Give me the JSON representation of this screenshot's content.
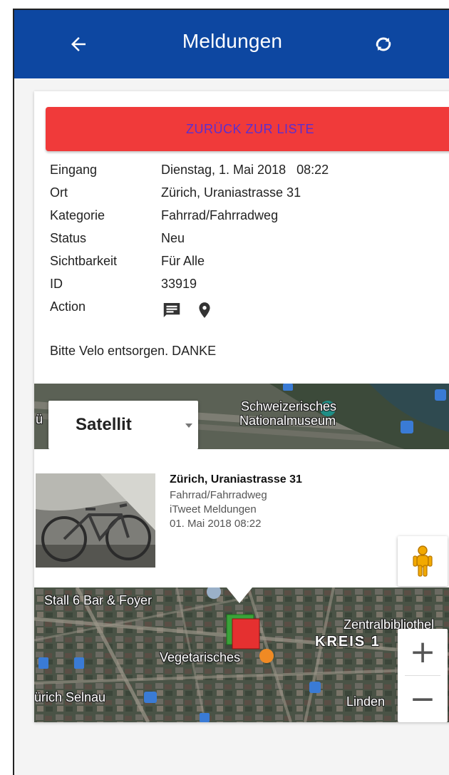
{
  "appbar": {
    "title": "Meldungen",
    "back_icon": "arrow-left-icon",
    "refresh_icon": "refresh-icon",
    "bg_color": "#0d47a1"
  },
  "back_button": {
    "label": "ZURÜCK ZUR LISTE",
    "bg_color": "#f03a3a",
    "text_color": "#5b2fd0"
  },
  "details": {
    "eingang_label": "Eingang",
    "eingang_value": "Dienstag, 1. Mai 2018   08:22",
    "ort_label": "Ort",
    "ort_value": "Zürich, Uraniastrasse 31",
    "kategorie_label": "Kategorie",
    "kategorie_value": "Fahrrad/Fahrradweg",
    "status_label": "Status",
    "status_value": "Neu",
    "sichtbarkeit_label": "Sichtbarkeit",
    "sichtbarkeit_value": "Für Alle",
    "id_label": "ID",
    "id_value": "33919",
    "action_label": "Action",
    "action_icons": [
      "comment-icon",
      "location-pin-icon"
    ]
  },
  "description": "Bitte Velo entsorgen. DANKE",
  "map": {
    "type_selector": "Satellit",
    "labels": {
      "museum": "Schweizerisches",
      "museum2": "Nationalmuseum",
      "edge_top": "ü",
      "stall": "Stall 6 Bar & Foyer",
      "zentral": "Zentralbibliothel",
      "kreis": "KREIS 1",
      "vegetarisch": "Vegetarisches",
      "selnau": "ürich Selnau",
      "linden": "Linden"
    },
    "zoom_in": "+",
    "zoom_out": "−",
    "pegman_icon": "pegman-icon",
    "marker_color": "#e53030"
  },
  "infowindow": {
    "title": "Zürich, Uraniastrasse 31",
    "category": "Fahrrad/Fahrradweg",
    "source": "iTweet Meldungen",
    "date": "01. Mai 2018 08:22"
  }
}
